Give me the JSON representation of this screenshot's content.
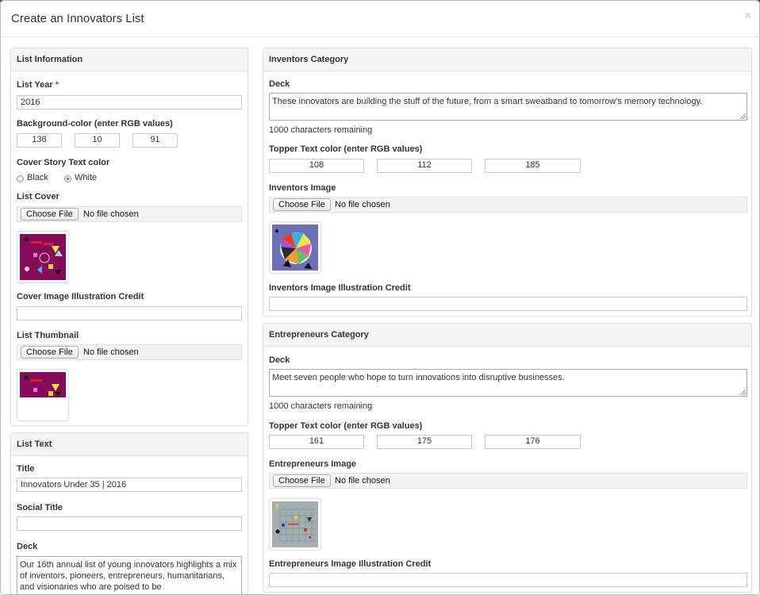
{
  "modal": {
    "title": "Create an Innovators List",
    "close_glyph": "×"
  },
  "list_information": {
    "heading": "List Information",
    "year_label": "List Year",
    "year_required": "*",
    "year_value": "2016",
    "bg_color_label": "Background-color (enter RGB values)",
    "bg_rgb": [
      "136",
      "10",
      "91"
    ],
    "text_color_label": "Cover Story Text color",
    "text_color_options": [
      "Black",
      "White"
    ],
    "text_color_selected": "White",
    "cover_label": "List Cover",
    "cover_file_button": "Choose File",
    "cover_file_status": "No file chosen",
    "cover_credit_label": "Cover Image Illustration Credit",
    "cover_credit_value": "",
    "thumbnail_label": "List Thumbnail",
    "thumbnail_file_button": "Choose File",
    "thumbnail_file_status": "No file chosen"
  },
  "list_text": {
    "heading": "List Text",
    "title_label": "Title",
    "title_value": "Innovators Under 35 | 2016",
    "social_title_label": "Social Title",
    "social_title_value": "",
    "deck_label": "Deck",
    "deck_value": "Our 16th annual list of young innovators highlights a mix of inventors, pioneers, entrepreneurs, humanitarians, and visionaries who are poised to be"
  },
  "inventors": {
    "heading": "Inventors Category",
    "deck_label": "Deck",
    "deck_value": "These innovators are building the stuff of the future, from a smart sweatband to tomorrow's memory technology.",
    "remaining": "1000 characters remaining",
    "topper_label": "Topper Text color (enter RGB values)",
    "topper_rgb": [
      "108",
      "112",
      "185"
    ],
    "image_label": "Inventors Image",
    "file_button": "Choose File",
    "file_status": "No file chosen",
    "credit_label": "Inventors Image Illustration Credit",
    "credit_value": ""
  },
  "entrepreneurs": {
    "heading": "Entrepreneurs Category",
    "deck_label": "Deck",
    "deck_value": "Meet seven people who hope to turn innovations into disruptive businesses.",
    "remaining": "1000 characters remaining",
    "topper_label": "Topper Text color (enter RGB values)",
    "topper_rgb": [
      "161",
      "175",
      "176"
    ],
    "image_label": "Entrepreneurs Image",
    "file_button": "Choose File",
    "file_status": "No file chosen",
    "credit_label": "Entrepreneurs Image Illustration Credit",
    "credit_value": ""
  },
  "colors": {
    "cover_bg": "#880a5b",
    "inventors_bg": "#6c70b9",
    "entrepreneurs_bg": "#a1afb0"
  }
}
